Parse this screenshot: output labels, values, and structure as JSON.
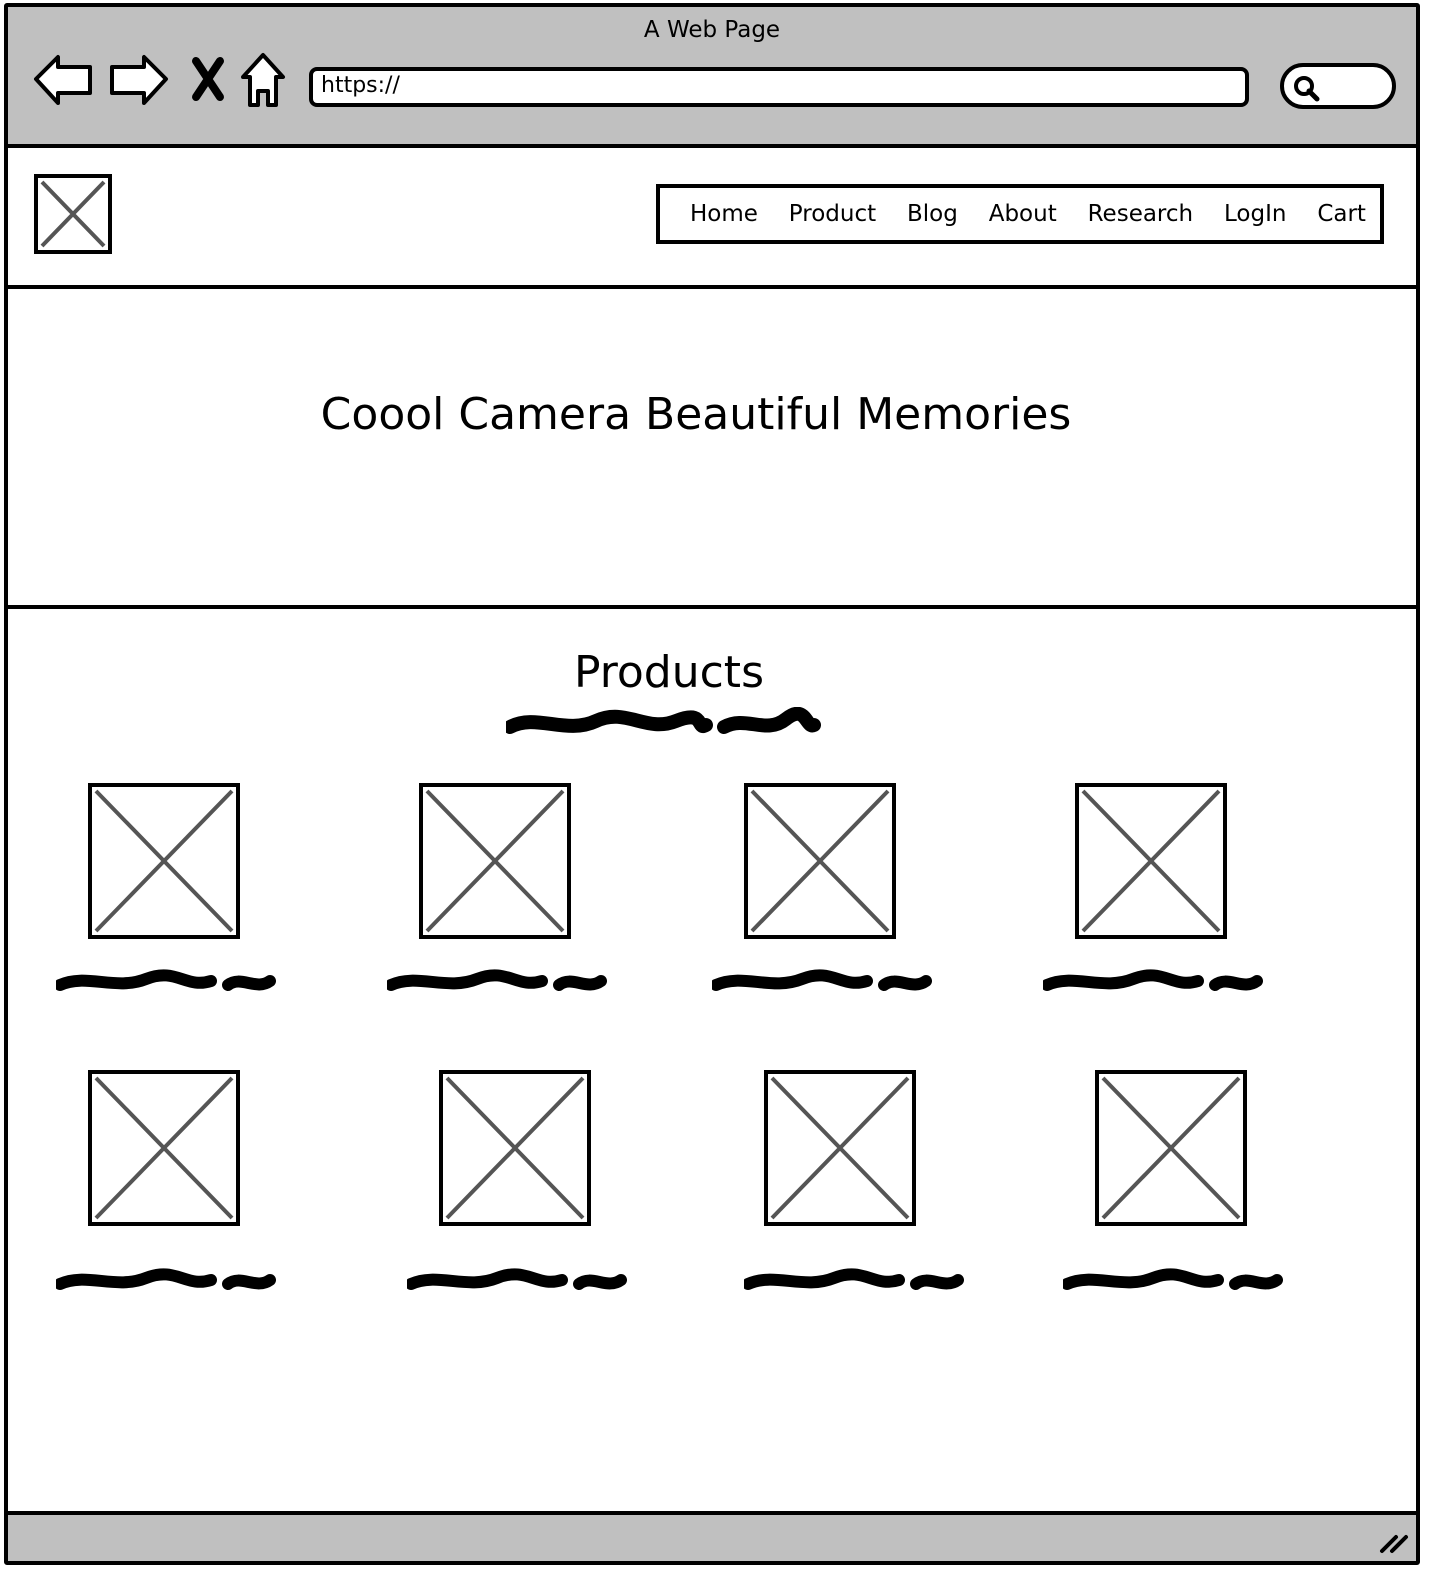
{
  "window": {
    "title": "A Web Page"
  },
  "browser": {
    "url": "https://",
    "back_icon": "arrow-left-icon",
    "forward_icon": "arrow-right-icon",
    "stop_icon": "close-icon",
    "home_icon": "home-icon",
    "search_icon": "search-icon"
  },
  "nav": {
    "items": [
      {
        "label": "Home"
      },
      {
        "label": "Product"
      },
      {
        "label": "Blog"
      },
      {
        "label": "About"
      },
      {
        "label": "Research"
      },
      {
        "label": "LogIn"
      },
      {
        "label": "Cart"
      }
    ]
  },
  "hero": {
    "title": "Coool Camera Beautiful Memories"
  },
  "products": {
    "title": "Products",
    "items_count_shown": 8
  }
}
